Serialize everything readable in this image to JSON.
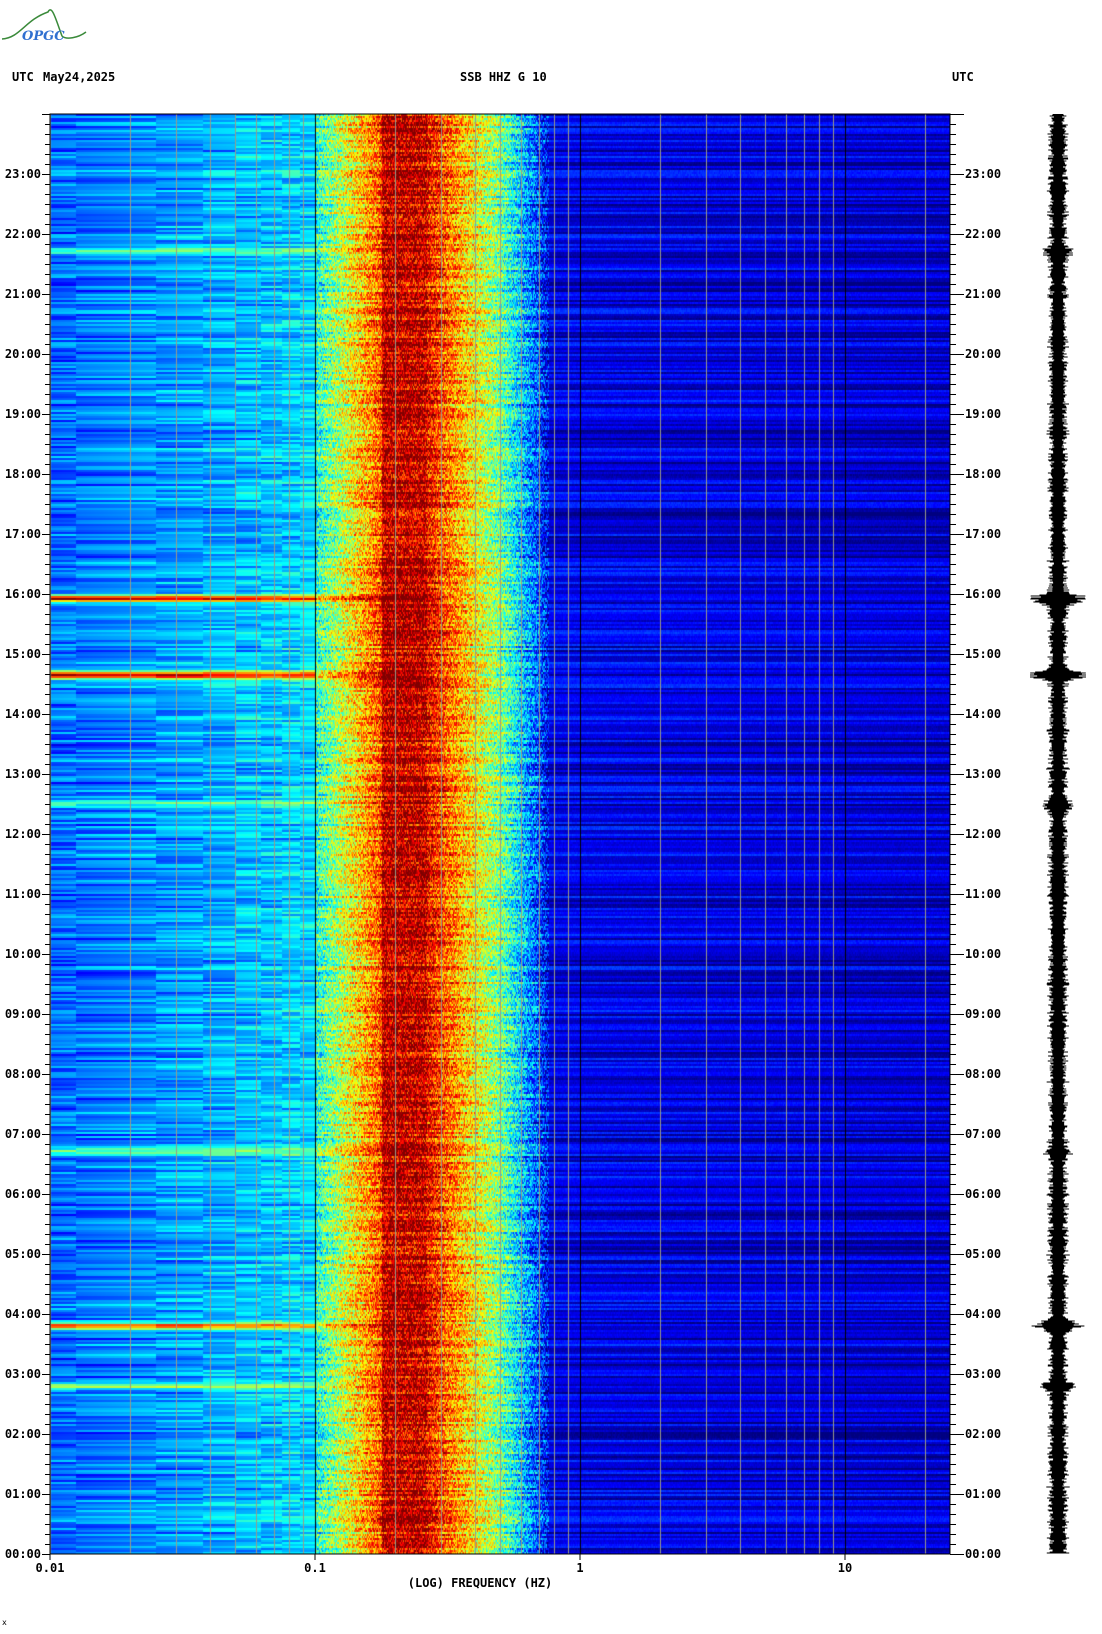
{
  "header": {
    "left_tz": "UTC",
    "date": "May24,2025",
    "station": "SSB HHZ G 10",
    "right_tz": "UTC"
  },
  "logo": {
    "text": "OPGC"
  },
  "footer_mark": "x",
  "colors": {
    "low": "#00008f",
    "mid": "#00ffff",
    "high": "#800000",
    "grid": "#9a9a88",
    "grid_major": "#000000"
  },
  "chart_data": {
    "type": "heatmap",
    "title": "SSB HHZ G 10",
    "xlabel": "(LOG) FREQUENCY (HZ)",
    "ylabel": "UTC",
    "xscale": "log",
    "xlim": [
      0.01,
      25
    ],
    "ylim_hours": [
      0,
      24
    ],
    "x_ticks": [
      {
        "value": 0.01,
        "label": "0.01"
      },
      {
        "value": 0.1,
        "label": "0.1"
      },
      {
        "value": 1,
        "label": "1"
      },
      {
        "value": 10,
        "label": "10"
      }
    ],
    "y_ticks": [
      "00:00",
      "01:00",
      "02:00",
      "03:00",
      "04:00",
      "05:00",
      "06:00",
      "07:00",
      "08:00",
      "09:00",
      "10:00",
      "11:00",
      "12:00",
      "13:00",
      "14:00",
      "15:00",
      "16:00",
      "17:00",
      "18:00",
      "19:00",
      "20:00",
      "21:00",
      "22:00",
      "23:00"
    ],
    "colormap": "jet",
    "dominant_band_hz": [
      0.18,
      0.27
    ],
    "energy_band_hz": [
      0.1,
      0.6
    ],
    "events": [
      {
        "time_hours": 15.92,
        "strength": 0.9,
        "description": "strong low-frequency event ~15:55"
      },
      {
        "time_hours": 14.65,
        "strength": 1.0,
        "description": "strong low-frequency event ~14:39"
      },
      {
        "time_hours": 3.8,
        "strength": 0.75,
        "description": "low-frequency event ~03:48"
      },
      {
        "time_hours": 2.8,
        "strength": 0.35,
        "description": "weak event ~02:48"
      },
      {
        "time_hours": 12.5,
        "strength": 0.3,
        "description": "weak event ~12:30"
      },
      {
        "time_hours": 6.7,
        "strength": 0.3,
        "description": "weak event ~06:42"
      },
      {
        "time_hours": 21.7,
        "strength": 0.3,
        "description": "weak event ~21:42"
      }
    ]
  }
}
